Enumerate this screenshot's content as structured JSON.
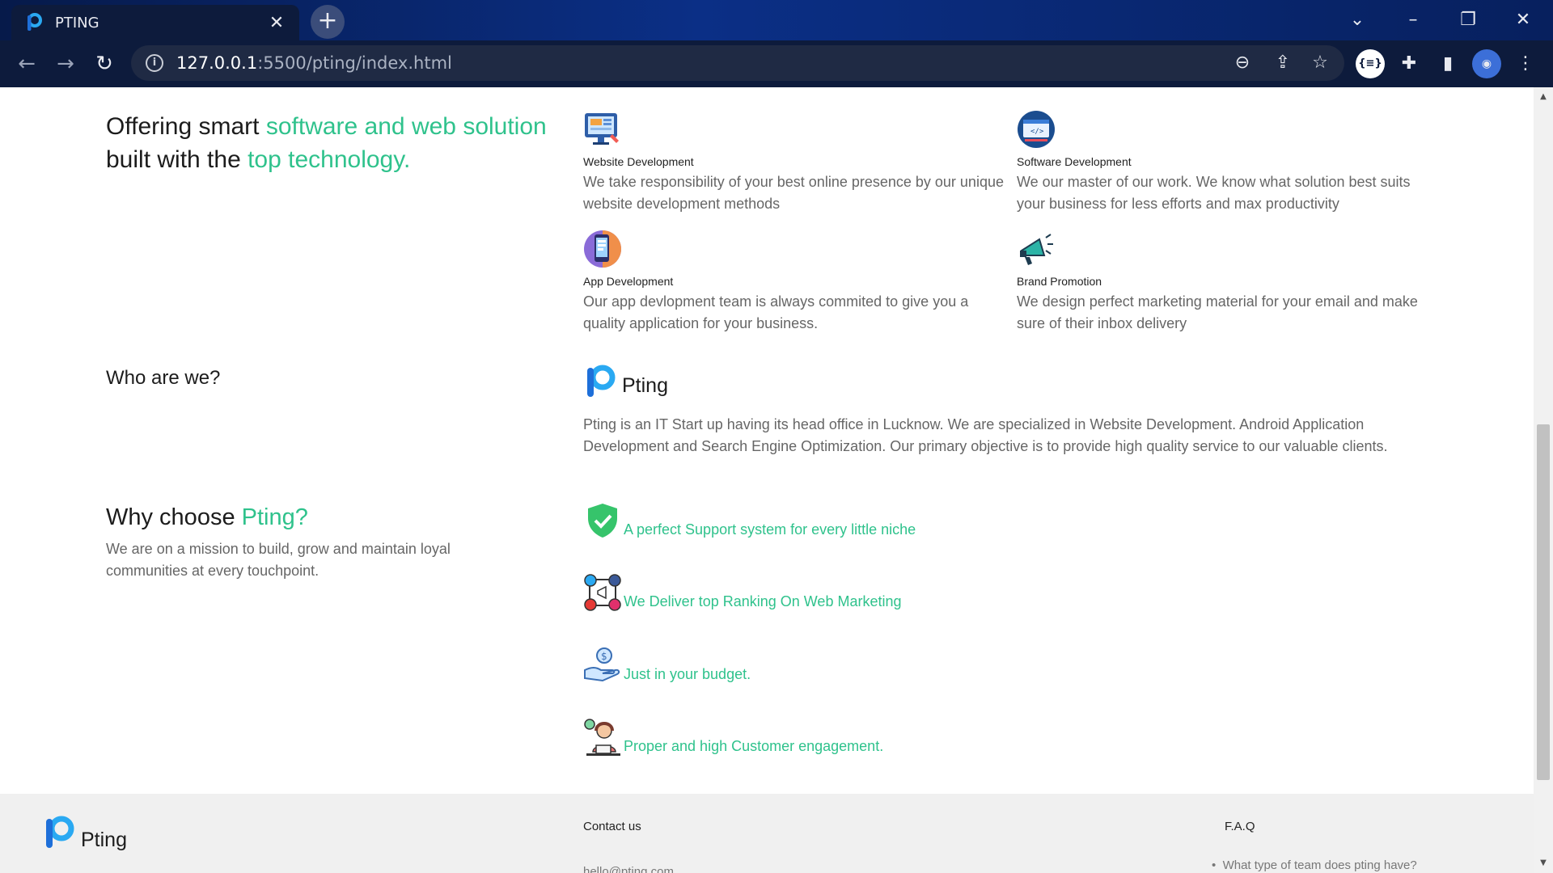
{
  "browser": {
    "tab_title": "PTING",
    "tab_close": "✕",
    "new_tab": "+",
    "url_host": "127.0.0.1",
    "url_path": ":5500/pting/index.html",
    "window_controls": [
      "chevron-down-icon",
      "minimize-icon",
      "restore-icon",
      "close-icon"
    ]
  },
  "colors": {
    "accent": "#2fc28c",
    "text": "#1c1c1c",
    "muted": "#666666",
    "footer_bg": "#f0f0f0",
    "brand_blue": "#1e88e5"
  },
  "hero": {
    "line1_prefix": "Offering smart ",
    "line1_accent": "software and web solution",
    "line2_prefix": "built with the ",
    "line2_accent": "top technology."
  },
  "services": [
    {
      "icon": "monitor-icon",
      "title": "Website Development",
      "desc": "We take responsibility of your best online presence by our unique website development methods"
    },
    {
      "icon": "code-screen-icon",
      "title": "Software Development",
      "desc": "We our master of our work. We know what solution best suits your business for less efforts and max productivity"
    },
    {
      "icon": "smartphone-icon",
      "title": "App Development",
      "desc": "Our app devlopment team is always commited to give you a quality application for your business."
    },
    {
      "icon": "megaphone-icon",
      "title": "Brand Promotion",
      "desc": "We design perfect marketing material for your email and make sure of their inbox delivery"
    }
  ],
  "about": {
    "heading": "Who are we?",
    "brand_name": "Pting",
    "text": "Pting is an IT Start up having its head office in Lucknow. We are specialized in Website Development. Android Application Development and Search Engine Optimization. Our primary objective is to provide high quality service to our valuable clients."
  },
  "why": {
    "title_prefix": "Why choose ",
    "title_accent": "Pting?",
    "subtitle": "We are on a mission to build, grow and maintain loyal communities at every touchpoint.",
    "features": [
      {
        "icon": "shield-check-icon",
        "text": "A perfect Support system for every little niche"
      },
      {
        "icon": "social-network-icon",
        "text": "We Deliver top Ranking On Web Marketing"
      },
      {
        "icon": "money-hand-icon",
        "text": "Just in your budget."
      },
      {
        "icon": "customer-support-icon",
        "text": "Proper and high Customer engagement."
      }
    ]
  },
  "footer": {
    "brand_name": "Pting",
    "contact_title": "Contact us",
    "contact_email": "hello@pting.com",
    "faq_title": "F.A.Q",
    "faq_first": "What type of team does pting have?"
  }
}
